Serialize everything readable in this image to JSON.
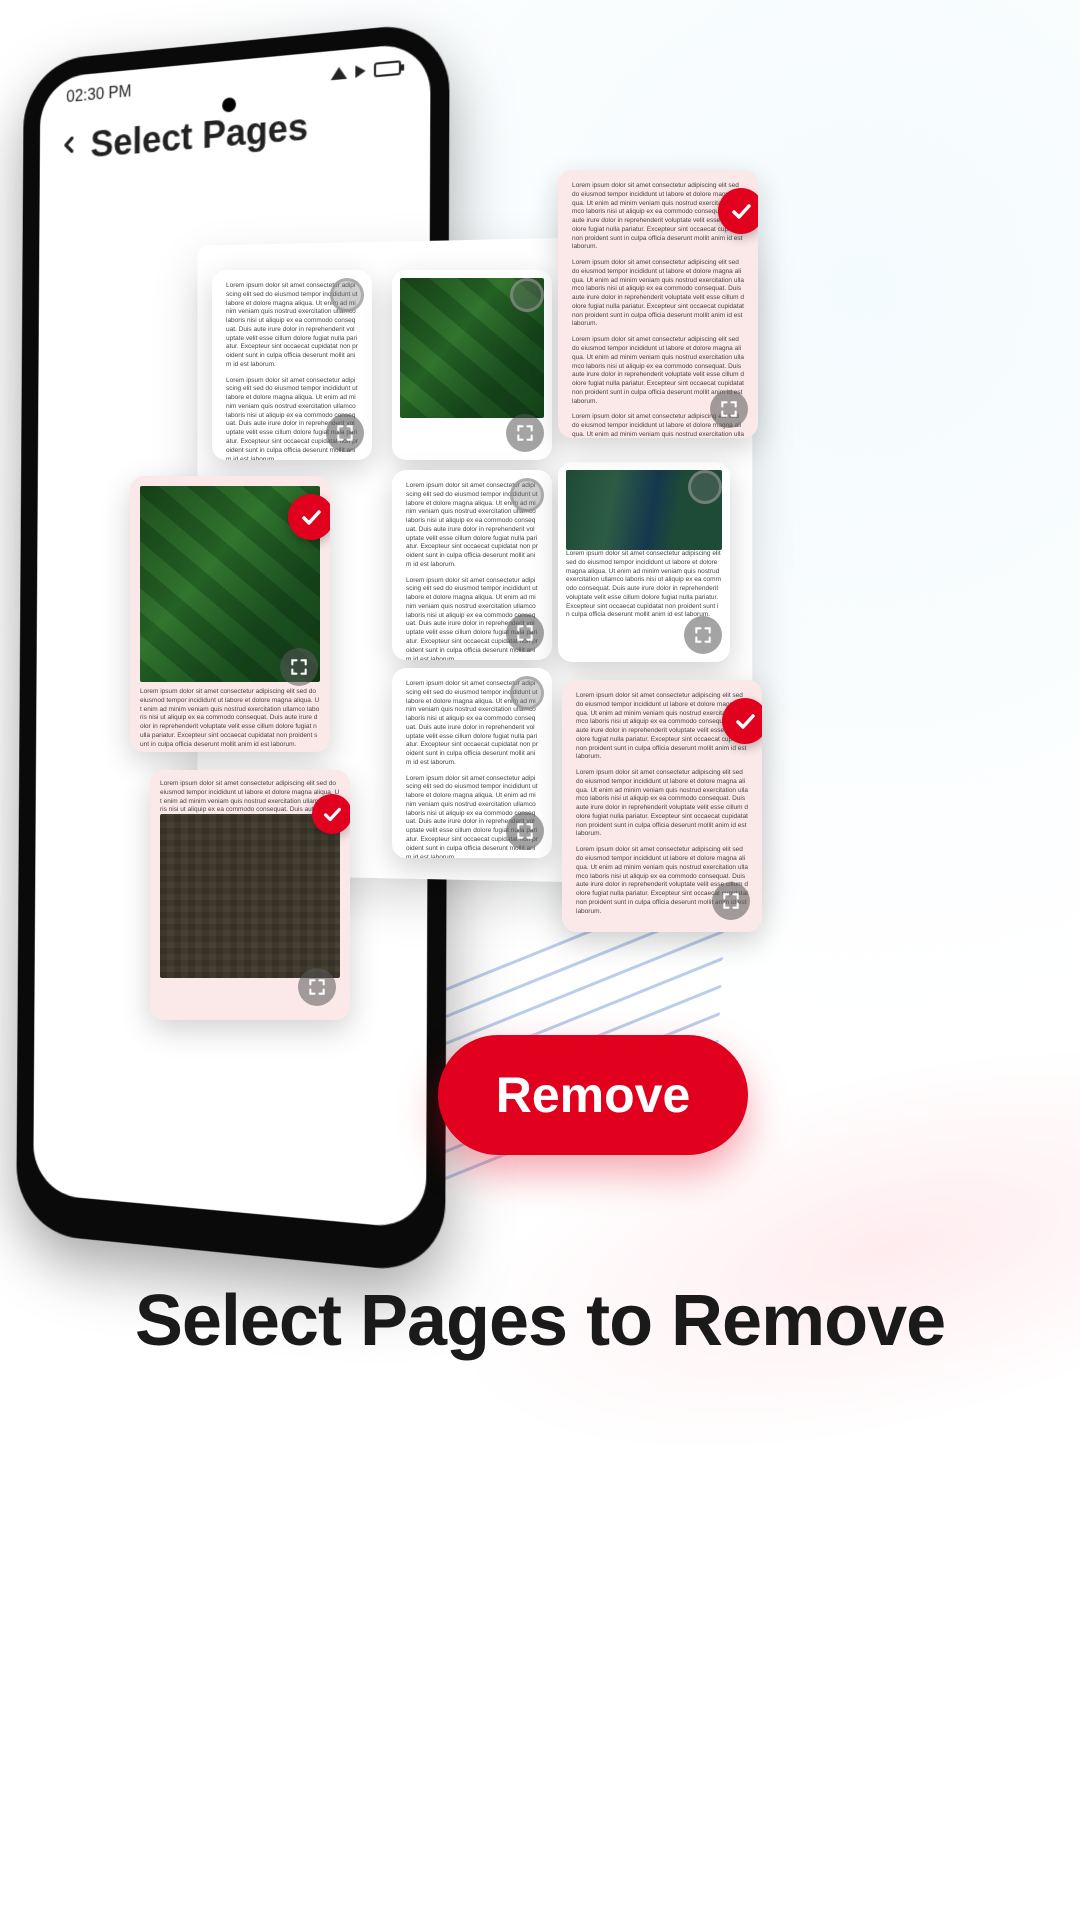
{
  "status_bar": {
    "time": "02:30 PM"
  },
  "header": {
    "title": "Select Pages"
  },
  "remove_button": {
    "label": "Remove"
  },
  "caption": "Select Pages to Remove",
  "icons": {
    "back": "chevron-left-icon",
    "check": "check-icon",
    "expand": "expand-icon",
    "wifi": "wifi-icon",
    "signal": "signal-icon",
    "battery": "battery-icon"
  },
  "thumbnails": [
    {
      "id": "t-text-1",
      "kind": "text",
      "selected": false,
      "pos": "canvas-top-left"
    },
    {
      "id": "t-sat-1",
      "kind": "sat",
      "selected": false,
      "pos": "canvas-top-right"
    },
    {
      "id": "t-text-5",
      "kind": "text",
      "selected": true,
      "pos": "float-top-right"
    },
    {
      "id": "t-sat-sel",
      "kind": "sat",
      "selected": true,
      "pos": "float-left-mid"
    },
    {
      "id": "t-text-2",
      "kind": "text",
      "selected": false,
      "pos": "canvas-mid"
    },
    {
      "id": "t-text-river",
      "kind": "river",
      "selected": false,
      "pos": "canvas-mid-right"
    },
    {
      "id": "t-text-3",
      "kind": "text",
      "selected": false,
      "pos": "canvas-bot"
    },
    {
      "id": "t-text-6",
      "kind": "text",
      "selected": true,
      "pos": "float-bot-right"
    },
    {
      "id": "t-city-sel",
      "kind": "city",
      "selected": true,
      "pos": "float-left-bot"
    }
  ],
  "lorem": "Lorem ipsum dolor sit amet consectetur adipiscing elit sed do eiusmod tempor incididunt ut labore et dolore magna aliqua. Ut enim ad minim veniam quis nostrud exercitation ullamco laboris nisi ut aliquip ex ea commodo consequat. Duis aute irure dolor in reprehenderit voluptate velit esse cillum dolore fugiat nulla pariatur. Excepteur sint occaecat cupidatat non proident sunt in culpa officia deserunt mollit anim id est laborum."
}
